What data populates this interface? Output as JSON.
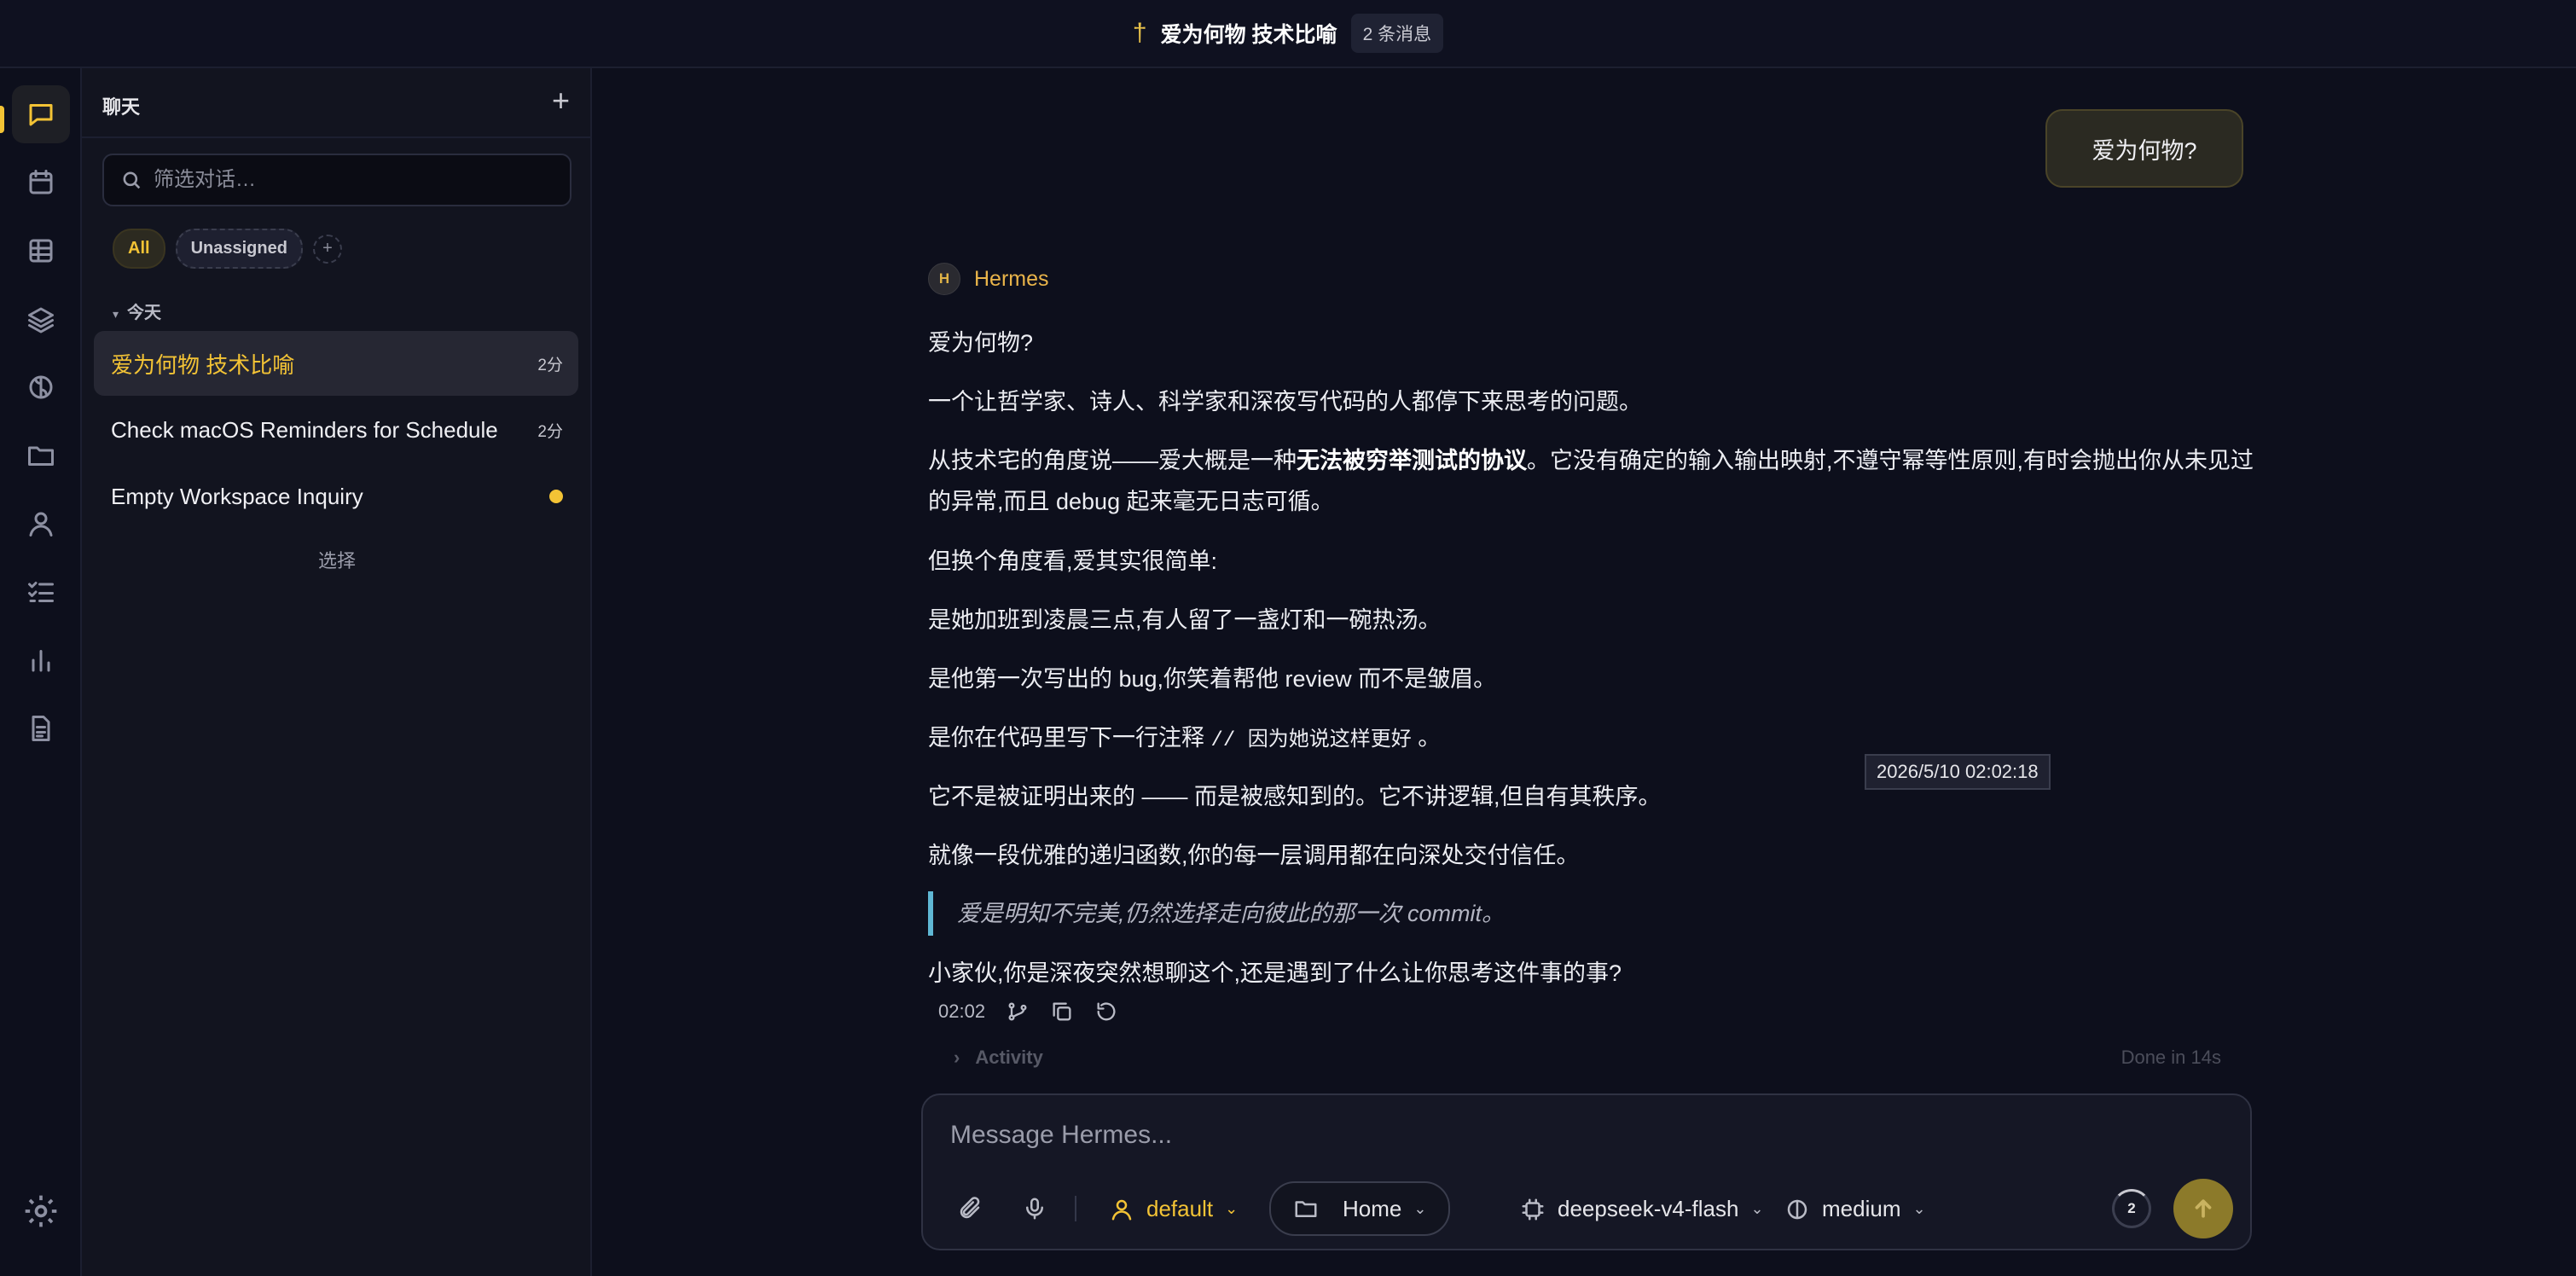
{
  "header": {
    "title": "爱为何物 技术比喻",
    "badge": "2 条消息"
  },
  "rail": {
    "items": [
      "chat-icon",
      "calendar-icon",
      "table-icon",
      "layers-icon",
      "brain-icon",
      "folder-icon",
      "user-icon",
      "checklist-icon",
      "bar-chart-icon",
      "document-icon"
    ],
    "settings": "gear-icon"
  },
  "sidebar": {
    "title": "聊天",
    "search_placeholder": "筛选对话…",
    "filters": [
      "All",
      "Unassigned"
    ],
    "group_label": "今天",
    "conversations": [
      {
        "title": "爱为何物 技术比喻",
        "meta": "2分",
        "active": true
      },
      {
        "title": "Check macOS Reminders for Schedule",
        "meta": "2分"
      },
      {
        "title": "Empty Workspace Inquiry",
        "meta": ""
      }
    ],
    "select_label": "选择"
  },
  "chat": {
    "user_message": "爱为何物?",
    "agent_initial": "H",
    "agent_name": "Hermes",
    "lines": {
      "l1": "爱为何物?",
      "l2": "一个让哲学家、诗人、科学家和深夜写代码的人都停下来思考的问题。",
      "l3_pre": "从技术宅的角度说——爱大概是一种",
      "l3_bold": "无法被穷举测试的协议",
      "l3_post": "。它没有确定的输入输出映射,不遵守幂等性原则,有时会抛出你从未见过的异常,而且 debug 起来毫无日志可循。",
      "l4": "但换个角度看,爱其实很简单:",
      "l5": "是她加班到凌晨三点,有人留了一盏灯和一碗热汤。",
      "l6": "是他第一次写出的 bug,你笑着帮他 review 而不是皱眉。",
      "l7_pre": "是你在代码里写下一行注释 ",
      "l7_code": "// 因为她说这样更好",
      "l7_post": " 。",
      "l8": "它不是被证明出来的 —— 而是被感知到的。它不讲逻辑,但自有其秩序。",
      "l9": "就像一段优雅的递归函数,你的每一层调用都在向深处交付信任。",
      "quote": "爱是明知不完美,仍然选择走向彼此的那一次 commit。",
      "l10": "小家伙,你是深夜突然想聊这个,还是遇到了什么让你思考这件事的事?"
    },
    "timestamp_tooltip": "2026/5/10 02:02:18",
    "message_time": "02:02",
    "activity_label": "Activity",
    "activity_status": "Done in 14s"
  },
  "composer": {
    "placeholder": "Message Hermes...",
    "persona": "default",
    "workspace": "Home",
    "model": "deepseek-v4-flash",
    "effort": "medium",
    "queue_count": "2"
  },
  "colors": {
    "accent": "#f3c335",
    "background": "#0d0f1c",
    "sidebar": "#12141f",
    "quote_bar": "#5fb7d4"
  }
}
